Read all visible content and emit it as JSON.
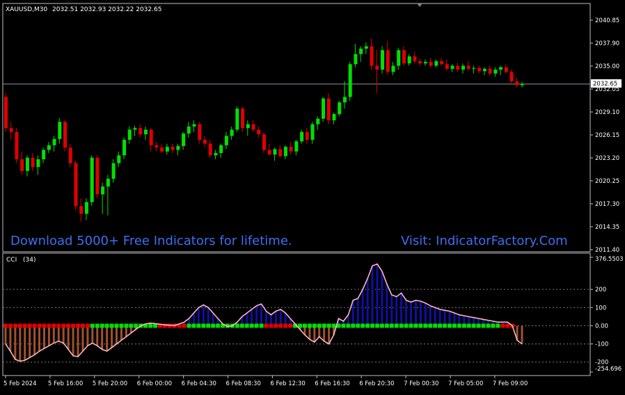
{
  "window": {
    "symbol_label": "XAUUSD,M30",
    "ohlc": "2032.51 2032.93 2032.22 2032.65"
  },
  "watermark": {
    "left": "Download 5000+ Free Indicators for lifetime.",
    "right": "Visit: IndicatorFactory.Com"
  },
  "colors": {
    "bull": "#00e000",
    "bear": "#e00000",
    "cci_pos": "#1010a0",
    "cci_neg": "#a0522d",
    "cci_line": "#ffb6c1",
    "watermark": "#3d6ff2"
  },
  "price_axis": {
    "ticks": [
      "2040.85",
      "2037.90",
      "2035.00",
      "2032.05",
      "2029.10",
      "2026.15",
      "2023.20",
      "2020.25",
      "2017.30",
      "2014.35",
      "2011.40"
    ],
    "current_price": "2032.65"
  },
  "indicator": {
    "label": "CCI",
    "period": "(34)",
    "axis_ticks": [
      "376.5503",
      "200",
      "100",
      "0.00",
      "-100",
      "-254.696"
    ],
    "extra_tick": "-200"
  },
  "time_axis": {
    "ticks": [
      "5 Feb 2024",
      "5 Feb 16:00",
      "5 Feb 20:00",
      "6 Feb 00:00",
      "6 Feb 04:30",
      "6 Feb 08:30",
      "6 Feb 12:30",
      "6 Feb 16:30",
      "6 Feb 20:30",
      "7 Feb 00:30",
      "7 Feb 05:00",
      "7 Feb 09:00"
    ]
  },
  "chart_data": [
    {
      "type": "candlestick",
      "title": "XAUUSD,M30",
      "ylim": [
        2011.4,
        2040.85
      ],
      "candles": [
        {
          "o": 2031.0,
          "h": 2031.5,
          "l": 2026.5,
          "c": 2027.0
        },
        {
          "o": 2027.0,
          "h": 2027.8,
          "l": 2025.5,
          "c": 2026.5
        },
        {
          "o": 2026.5,
          "h": 2027.0,
          "l": 2022.5,
          "c": 2023.0
        },
        {
          "o": 2023.0,
          "h": 2024.0,
          "l": 2021.0,
          "c": 2021.5
        },
        {
          "o": 2021.5,
          "h": 2023.5,
          "l": 2020.8,
          "c": 2023.2
        },
        {
          "o": 2023.2,
          "h": 2023.8,
          "l": 2021.5,
          "c": 2022.0
        },
        {
          "o": 2022.0,
          "h": 2023.5,
          "l": 2021.0,
          "c": 2023.0
        },
        {
          "o": 2023.0,
          "h": 2024.5,
          "l": 2022.5,
          "c": 2024.2
        },
        {
          "o": 2024.2,
          "h": 2025.2,
          "l": 2023.8,
          "c": 2024.8
        },
        {
          "o": 2024.8,
          "h": 2026.0,
          "l": 2024.0,
          "c": 2025.6
        },
        {
          "o": 2025.6,
          "h": 2028.3,
          "l": 2025.0,
          "c": 2027.8
        },
        {
          "o": 2027.8,
          "h": 2028.0,
          "l": 2024.0,
          "c": 2024.5
        },
        {
          "o": 2024.5,
          "h": 2025.0,
          "l": 2022.0,
          "c": 2022.5
        },
        {
          "o": 2022.5,
          "h": 2022.8,
          "l": 2016.5,
          "c": 2017.0
        },
        {
          "o": 2017.0,
          "h": 2018.0,
          "l": 2015.0,
          "c": 2016.0
        },
        {
          "o": 2016.0,
          "h": 2018.0,
          "l": 2015.2,
          "c": 2017.5
        },
        {
          "o": 2017.5,
          "h": 2023.5,
          "l": 2017.0,
          "c": 2023.2
        },
        {
          "o": 2023.2,
          "h": 2023.5,
          "l": 2018.0,
          "c": 2018.5
        },
        {
          "o": 2018.5,
          "h": 2020.0,
          "l": 2016.0,
          "c": 2019.5
        },
        {
          "o": 2019.5,
          "h": 2021.0,
          "l": 2015.8,
          "c": 2020.5
        },
        {
          "o": 2020.5,
          "h": 2023.0,
          "l": 2020.0,
          "c": 2022.5
        },
        {
          "o": 2022.5,
          "h": 2024.0,
          "l": 2022.0,
          "c": 2023.5
        },
        {
          "o": 2023.5,
          "h": 2025.8,
          "l": 2023.0,
          "c": 2025.5
        },
        {
          "o": 2025.5,
          "h": 2027.2,
          "l": 2025.0,
          "c": 2026.8
        },
        {
          "o": 2026.8,
          "h": 2027.3,
          "l": 2026.0,
          "c": 2027.0
        },
        {
          "o": 2027.0,
          "h": 2027.5,
          "l": 2025.8,
          "c": 2026.2
        },
        {
          "o": 2026.2,
          "h": 2027.2,
          "l": 2025.5,
          "c": 2026.8
        },
        {
          "o": 2026.8,
          "h": 2027.0,
          "l": 2024.0,
          "c": 2024.8
        },
        {
          "o": 2024.8,
          "h": 2025.2,
          "l": 2024.0,
          "c": 2024.5
        },
        {
          "o": 2024.5,
          "h": 2025.0,
          "l": 2023.8,
          "c": 2024.0
        },
        {
          "o": 2024.0,
          "h": 2025.0,
          "l": 2023.6,
          "c": 2024.6
        },
        {
          "o": 2024.6,
          "h": 2025.0,
          "l": 2023.8,
          "c": 2024.2
        },
        {
          "o": 2024.2,
          "h": 2025.0,
          "l": 2023.5,
          "c": 2024.7
        },
        {
          "o": 2024.7,
          "h": 2026.5,
          "l": 2024.2,
          "c": 2026.3
        },
        {
          "o": 2026.3,
          "h": 2027.8,
          "l": 2025.8,
          "c": 2027.2
        },
        {
          "o": 2027.2,
          "h": 2028.0,
          "l": 2026.5,
          "c": 2027.5
        },
        {
          "o": 2027.5,
          "h": 2027.8,
          "l": 2025.0,
          "c": 2025.5
        },
        {
          "o": 2025.5,
          "h": 2026.0,
          "l": 2024.5,
          "c": 2025.0
        },
        {
          "o": 2025.0,
          "h": 2025.5,
          "l": 2023.2,
          "c": 2023.5
        },
        {
          "o": 2023.5,
          "h": 2024.2,
          "l": 2023.0,
          "c": 2023.8
        },
        {
          "o": 2023.8,
          "h": 2025.0,
          "l": 2023.2,
          "c": 2024.8
        },
        {
          "o": 2024.8,
          "h": 2026.5,
          "l": 2024.3,
          "c": 2026.0
        },
        {
          "o": 2026.0,
          "h": 2027.2,
          "l": 2025.5,
          "c": 2026.8
        },
        {
          "o": 2026.8,
          "h": 2029.8,
          "l": 2026.5,
          "c": 2029.5
        },
        {
          "o": 2029.5,
          "h": 2029.8,
          "l": 2026.5,
          "c": 2027.0
        },
        {
          "o": 2027.0,
          "h": 2028.0,
          "l": 2026.0,
          "c": 2027.5
        },
        {
          "o": 2027.5,
          "h": 2028.0,
          "l": 2026.5,
          "c": 2026.8
        },
        {
          "o": 2026.8,
          "h": 2027.2,
          "l": 2025.8,
          "c": 2026.2
        },
        {
          "o": 2026.2,
          "h": 2026.5,
          "l": 2023.8,
          "c": 2024.2
        },
        {
          "o": 2024.2,
          "h": 2025.0,
          "l": 2023.5,
          "c": 2023.6
        },
        {
          "o": 2023.6,
          "h": 2024.5,
          "l": 2022.8,
          "c": 2024.3
        },
        {
          "o": 2024.3,
          "h": 2024.8,
          "l": 2023.2,
          "c": 2023.4
        },
        {
          "o": 2023.4,
          "h": 2024.8,
          "l": 2023.0,
          "c": 2024.6
        },
        {
          "o": 2024.6,
          "h": 2025.2,
          "l": 2023.6,
          "c": 2024.0
        },
        {
          "o": 2024.0,
          "h": 2025.5,
          "l": 2023.5,
          "c": 2025.3
        },
        {
          "o": 2025.3,
          "h": 2026.8,
          "l": 2025.0,
          "c": 2026.5
        },
        {
          "o": 2026.5,
          "h": 2027.0,
          "l": 2025.0,
          "c": 2025.5
        },
        {
          "o": 2025.5,
          "h": 2027.8,
          "l": 2025.0,
          "c": 2027.5
        },
        {
          "o": 2027.5,
          "h": 2028.5,
          "l": 2026.8,
          "c": 2028.2
        },
        {
          "o": 2028.2,
          "h": 2031.0,
          "l": 2027.8,
          "c": 2030.8
        },
        {
          "o": 2030.8,
          "h": 2031.5,
          "l": 2027.5,
          "c": 2028.0
        },
        {
          "o": 2028.0,
          "h": 2029.0,
          "l": 2027.5,
          "c": 2028.8
        },
        {
          "o": 2028.8,
          "h": 2030.5,
          "l": 2028.5,
          "c": 2030.3
        },
        {
          "o": 2030.3,
          "h": 2033.0,
          "l": 2029.5,
          "c": 2031.0
        },
        {
          "o": 2031.0,
          "h": 2035.5,
          "l": 2030.5,
          "c": 2035.2
        },
        {
          "o": 2035.2,
          "h": 2037.8,
          "l": 2034.8,
          "c": 2036.5
        },
        {
          "o": 2036.5,
          "h": 2037.5,
          "l": 2035.5,
          "c": 2037.2
        },
        {
          "o": 2037.2,
          "h": 2038.0,
          "l": 2036.5,
          "c": 2037.5
        },
        {
          "o": 2037.5,
          "h": 2038.5,
          "l": 2034.5,
          "c": 2035.0
        },
        {
          "o": 2035.0,
          "h": 2037.0,
          "l": 2031.5,
          "c": 2034.5
        },
        {
          "o": 2034.5,
          "h": 2037.5,
          "l": 2034.0,
          "c": 2037.0
        },
        {
          "o": 2037.0,
          "h": 2038.2,
          "l": 2033.8,
          "c": 2034.2
        },
        {
          "o": 2034.2,
          "h": 2035.5,
          "l": 2033.8,
          "c": 2035.0
        },
        {
          "o": 2035.0,
          "h": 2037.3,
          "l": 2034.5,
          "c": 2037.0
        },
        {
          "o": 2037.0,
          "h": 2037.5,
          "l": 2035.0,
          "c": 2035.3
        },
        {
          "o": 2035.3,
          "h": 2036.5,
          "l": 2035.0,
          "c": 2036.2
        },
        {
          "o": 2036.2,
          "h": 2036.8,
          "l": 2035.3,
          "c": 2035.6
        },
        {
          "o": 2035.6,
          "h": 2035.9,
          "l": 2035.0,
          "c": 2035.3
        },
        {
          "o": 2035.3,
          "h": 2035.8,
          "l": 2035.0,
          "c": 2035.5
        },
        {
          "o": 2035.5,
          "h": 2036.0,
          "l": 2034.8,
          "c": 2035.0
        },
        {
          "o": 2035.0,
          "h": 2035.8,
          "l": 2034.8,
          "c": 2035.6
        },
        {
          "o": 2035.6,
          "h": 2036.0,
          "l": 2035.0,
          "c": 2035.2
        },
        {
          "o": 2035.2,
          "h": 2035.8,
          "l": 2034.3,
          "c": 2034.6
        },
        {
          "o": 2034.6,
          "h": 2035.2,
          "l": 2034.2,
          "c": 2035.0
        },
        {
          "o": 2035.0,
          "h": 2035.4,
          "l": 2034.2,
          "c": 2034.5
        },
        {
          "o": 2034.5,
          "h": 2035.3,
          "l": 2034.0,
          "c": 2035.0
        },
        {
          "o": 2035.0,
          "h": 2035.6,
          "l": 2034.3,
          "c": 2034.6
        },
        {
          "o": 2034.6,
          "h": 2035.0,
          "l": 2034.0,
          "c": 2034.7
        },
        {
          "o": 2034.7,
          "h": 2035.0,
          "l": 2034.0,
          "c": 2034.3
        },
        {
          "o": 2034.3,
          "h": 2034.8,
          "l": 2033.8,
          "c": 2034.6
        },
        {
          "o": 2034.6,
          "h": 2035.0,
          "l": 2033.8,
          "c": 2034.0
        },
        {
          "o": 2034.0,
          "h": 2034.8,
          "l": 2033.6,
          "c": 2034.5
        },
        {
          "o": 2034.5,
          "h": 2035.0,
          "l": 2033.8,
          "c": 2034.8
        },
        {
          "o": 2034.8,
          "h": 2035.2,
          "l": 2034.0,
          "c": 2034.2
        },
        {
          "o": 2034.2,
          "h": 2034.5,
          "l": 2032.8,
          "c": 2033.0
        },
        {
          "o": 2033.0,
          "h": 2033.5,
          "l": 2032.2,
          "c": 2032.5
        },
        {
          "o": 2032.5,
          "h": 2032.93,
          "l": 2032.22,
          "c": 2032.65
        }
      ]
    },
    {
      "type": "bar",
      "title": "CCI (34)",
      "ylim": [
        -254.696,
        376.5503
      ],
      "values": [
        -100,
        -140,
        -185,
        -195,
        -190,
        -175,
        -160,
        -140,
        -125,
        -110,
        -95,
        -85,
        -95,
        -130,
        -165,
        -170,
        -140,
        -110,
        -95,
        -110,
        -130,
        -140,
        -120,
        -100,
        -80,
        -60,
        -40,
        -20,
        0,
        10,
        15,
        12,
        8,
        5,
        3,
        2,
        10,
        20,
        40,
        70,
        100,
        115,
        100,
        70,
        40,
        10,
        -5,
        0,
        20,
        50,
        70,
        90,
        110,
        120,
        80,
        60,
        80,
        90,
        70,
        40,
        10,
        -20,
        -50,
        -75,
        -90,
        -60,
        -85,
        -100,
        -50,
        40,
        25,
        60,
        140,
        150,
        200,
        260,
        330,
        340,
        300,
        230,
        170,
        160,
        180,
        140,
        130,
        140,
        135,
        125,
        110,
        100,
        90,
        85,
        80,
        70,
        60,
        55,
        50,
        45,
        40,
        35,
        30,
        25,
        20,
        20,
        20,
        0,
        -80,
        -100
      ],
      "state_colors": [
        "bear",
        "bear",
        "bear",
        "bear",
        "bear",
        "bear",
        "bear",
        "bear",
        "bear",
        "bear",
        "bear",
        "bear",
        "bear",
        "bear",
        "bear",
        "bear",
        "bear",
        "bear",
        "bull",
        "bull",
        "bull",
        "bull",
        "bull",
        "bull",
        "bull",
        "bull",
        "bull",
        "bull",
        "bull",
        "bull",
        "bull",
        "bull",
        "bear",
        "bear",
        "bear",
        "bear",
        "bear",
        "bear",
        "bull",
        "bull",
        "bull",
        "bull",
        "bull",
        "bull",
        "bull",
        "bull",
        "bull",
        "bull",
        "bull",
        "bull",
        "bull",
        "bull",
        "bull",
        "bull",
        "bear",
        "bear",
        "bear",
        "bear",
        "bear",
        "bear",
        "bull",
        "bull",
        "bull",
        "bull",
        "bull",
        "bull",
        "bull",
        "bull",
        "bull",
        "bull",
        "bull",
        "bull",
        "bull",
        "bull",
        "bull",
        "bull",
        "bull",
        "bull",
        "bull",
        "bull",
        "bull",
        "bull",
        "bull",
        "bull",
        "bull",
        "bull",
        "bull",
        "bull",
        "bull",
        "bull",
        "bull",
        "bull",
        "bull",
        "bull",
        "bull",
        "bull",
        "bull",
        "bull",
        "bull",
        "bull",
        "bull",
        "bull",
        "bull",
        "bear",
        "bear",
        "bear"
      ]
    }
  ]
}
